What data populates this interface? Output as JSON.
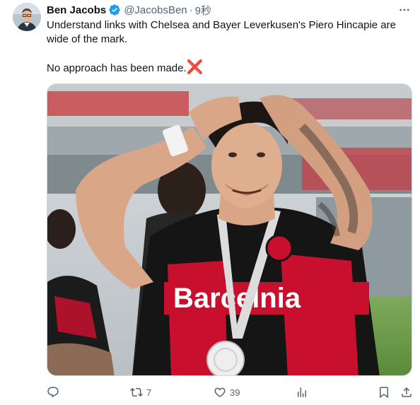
{
  "author": {
    "name": "Ben Jacobs",
    "handle": "@JacobsBen",
    "separator": "·",
    "time": "9秒"
  },
  "tweet": {
    "line1": "Understand links with Chelsea and Bayer Leverkusen's Piero Hincapie are wide of the mark.",
    "line2": "No approach has been made.",
    "line2_emoji": "❌"
  },
  "photo": {
    "shirt_text": "Barcelnia"
  },
  "actions": {
    "reply_count": "",
    "retweet_count": "7",
    "like_count": "39",
    "views_count": ""
  },
  "colors": {
    "accent": "#1d9bf0",
    "muted": "#536471",
    "jersey_red": "#c8102e",
    "jersey_black": "#151515"
  },
  "icons": [
    "verified-badge-icon",
    "more-icon",
    "reply-icon",
    "retweet-icon",
    "like-icon",
    "views-icon",
    "bookmark-icon",
    "share-icon"
  ]
}
